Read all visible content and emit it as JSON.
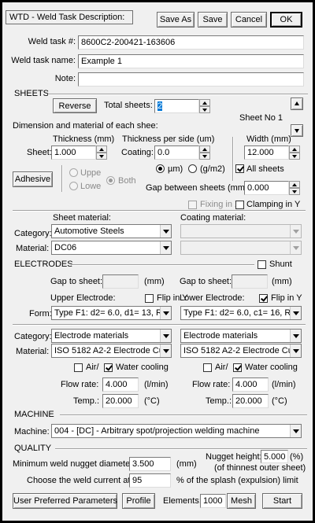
{
  "header": {
    "title": "WTD - Weld Task Description:",
    "save_as": "Save As",
    "save": "Save",
    "cancel": "Cancel",
    "ok": "OK"
  },
  "task": {
    "number_label": "Weld task #:",
    "number_value": "8600C2-200421-163606",
    "name_label": "Weld task name:",
    "name_value": "Example 1",
    "note_label": "Note:",
    "note_value": ""
  },
  "sheets": {
    "section": "SHEETS",
    "reverse": "Reverse",
    "total_label": "Total sheets:",
    "total_value": "2",
    "sheet_no": "Sheet No 1",
    "dim_label": "Dimension and material of each shee:",
    "thickness_label": "Thickness (mm)",
    "sheet_label": "Sheet:",
    "thickness_value": "1.000",
    "coating_header": "Thickness per side (um)",
    "coating_label": "Coating:",
    "coating_value": "0.0",
    "unit_um": "µm)",
    "unit_gm2": "(g/m2)",
    "width_label": "Width (mm)",
    "width_value": "12.000",
    "all_sheets": "All sheets",
    "adhesive": "Adhesive",
    "upper": "Uppe",
    "lower": "Lowe",
    "both": "Both",
    "gap_label": "Gap between sheets (mm):",
    "gap_value": "0.000",
    "fixing": "Fixing in X",
    "clamping": "Clamping in Y",
    "sheet_material_label": "Sheet material:",
    "coating_material_label": "Coating material:",
    "category_label": "Category:",
    "category_value": "Automotive Steels",
    "material_label": "Material:",
    "material_value": "DC06"
  },
  "electrodes": {
    "section": "ELECTRODES",
    "shunt": "Shunt",
    "gap_label_upper": "Gap to sheet:",
    "gap_unit_upper": "(mm)",
    "gap_label_lower": "Gap to sheet:",
    "gap_unit_lower": "(mm)",
    "upper_label": "Upper Electrode:",
    "lower_label": "Lower Electrode:",
    "flip_upper": "Flip in Y",
    "flip_lower": "Flip in Y",
    "form_label": "Form:",
    "form_upper": "Type F1:  d2= 6.0,  d1= 13,  R",
    "form_lower": "Type F1:  d2= 6.0,  c1= 16,  R",
    "category_label": "Category:",
    "category_upper": "Electrode materials",
    "category_lower": "Electrode materials",
    "material_label": "Material:",
    "material_upper": "ISO 5182   A2-2 Electrode Cu",
    "material_lower": "ISO 5182   A2-2 Electrode Cu",
    "air_upper": "Air/",
    "water_upper": "Water cooling",
    "air_lower": "Air/",
    "water_lower": "Water cooling",
    "flow_label_upper": "Flow rate:",
    "flow_value_upper": "4.000",
    "flow_unit_upper": "(l/min)",
    "flow_label_lower": "Flow rate:",
    "flow_value_lower": "4.000",
    "flow_unit_lower": "(l/min)",
    "temp_label_upper": "Temp.:",
    "temp_value_upper": "20.000",
    "temp_unit_upper": "(°C)",
    "temp_label_lower": "Temp.:",
    "temp_value_lower": "20.000",
    "temp_unit_lower": "(°C)"
  },
  "machine": {
    "section": "MACHINE",
    "label": "Machine:",
    "value": "004 - [DC] - Arbitrary spot/projection welding machine"
  },
  "quality": {
    "section": "QUALITY",
    "nugget_label": "Minimum weld nugget diameter:",
    "nugget_value": "3.500",
    "nugget_unit": "(mm)",
    "height_label": "Nugget height:",
    "height_value": "5.000",
    "height_unit": "(%)",
    "height_note": "(of thinnest outer sheet)",
    "current_label": "Choose the weld current at:",
    "current_value": "95",
    "current_note": "% of the splash (expulsion) limit"
  },
  "footer": {
    "user_params": "User Preferred Parameters",
    "profile": "Profile",
    "elements_label": "Elements:",
    "elements_value": "1000",
    "mesh": "Mesh",
    "start": "Start"
  }
}
